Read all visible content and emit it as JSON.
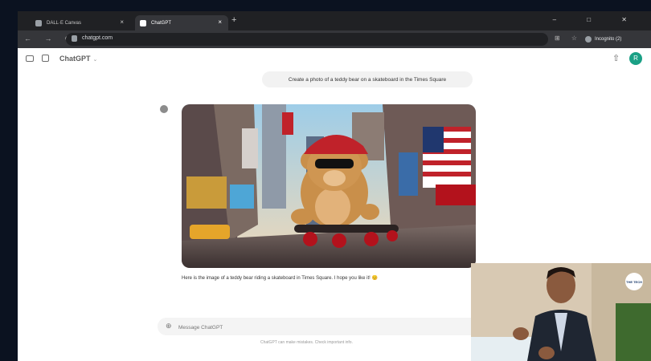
{
  "browser": {
    "tabs": [
      {
        "label": "DALL·E Canvas",
        "active": false
      },
      {
        "label": "ChatGPT",
        "active": true
      }
    ],
    "new_tab_glyph": "+",
    "window_controls": "– □ ✕",
    "nav_glyphs": "← → ⟳",
    "url": "chatgpt.com",
    "toolbar_icons": "⊞ ☆",
    "profile_label": "Incognito (2)"
  },
  "app": {
    "model_label": "ChatGPT",
    "model_chevron": "⌄",
    "avatar_letter": "R",
    "share_glyph": "⇧"
  },
  "chat": {
    "user_message": "Create a photo of a teddy bear on a skateboard in the Times Square",
    "image_subject": "teddy bear in cap and sunglasses riding a skateboard in Times Square",
    "assistant_reply": "Here is the image of a teddy bear riding a skateboard in Times Square. I hope you like it! 😊"
  },
  "composer": {
    "placeholder": "Message ChatGPT",
    "attach_glyph": "⊕"
  },
  "footer": {
    "disclaimer": "ChatGPT can make mistakes. Check important info."
  },
  "webcam": {
    "badge_text": "THE TECH"
  },
  "colors": {
    "accent": "#1aa085",
    "browser_dark": "#202124",
    "toolbar": "#35363a"
  }
}
